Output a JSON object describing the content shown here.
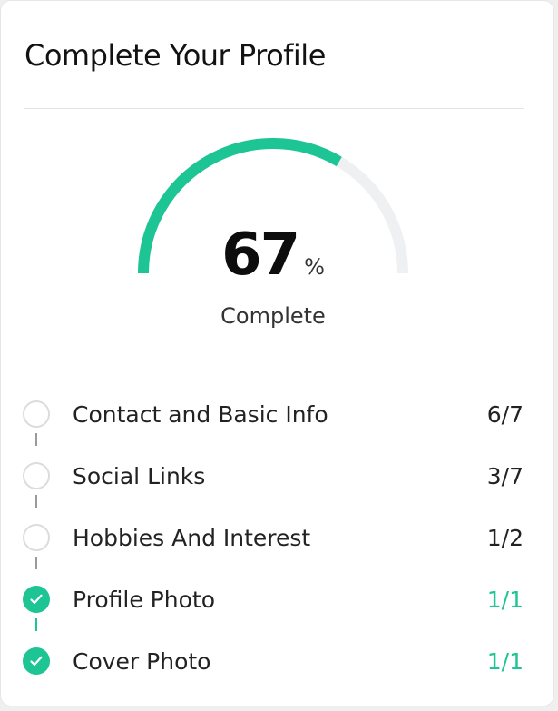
{
  "card": {
    "title": "Complete Your Profile"
  },
  "progress": {
    "percent": 67,
    "value_text": "67",
    "unit": "%",
    "caption": "Complete",
    "fill_color": "#1dc494",
    "track_color": "#eef0f2"
  },
  "steps": [
    {
      "label": "Contact and Basic Info",
      "count": "6/7",
      "complete": false,
      "icon": "empty-circle-icon"
    },
    {
      "label": "Social Links",
      "count": "3/7",
      "complete": false,
      "icon": "empty-circle-icon"
    },
    {
      "label": "Hobbies And Interest",
      "count": "1/2",
      "complete": false,
      "icon": "empty-circle-icon"
    },
    {
      "label": "Profile Photo",
      "count": "1/1",
      "complete": true,
      "icon": "check-circle-icon"
    },
    {
      "label": "Cover Photo",
      "count": "1/1",
      "complete": true,
      "icon": "check-circle-icon"
    }
  ],
  "colors": {
    "accent": "#1dc494",
    "text": "#222222",
    "pending_border": "#dcdcdc"
  }
}
